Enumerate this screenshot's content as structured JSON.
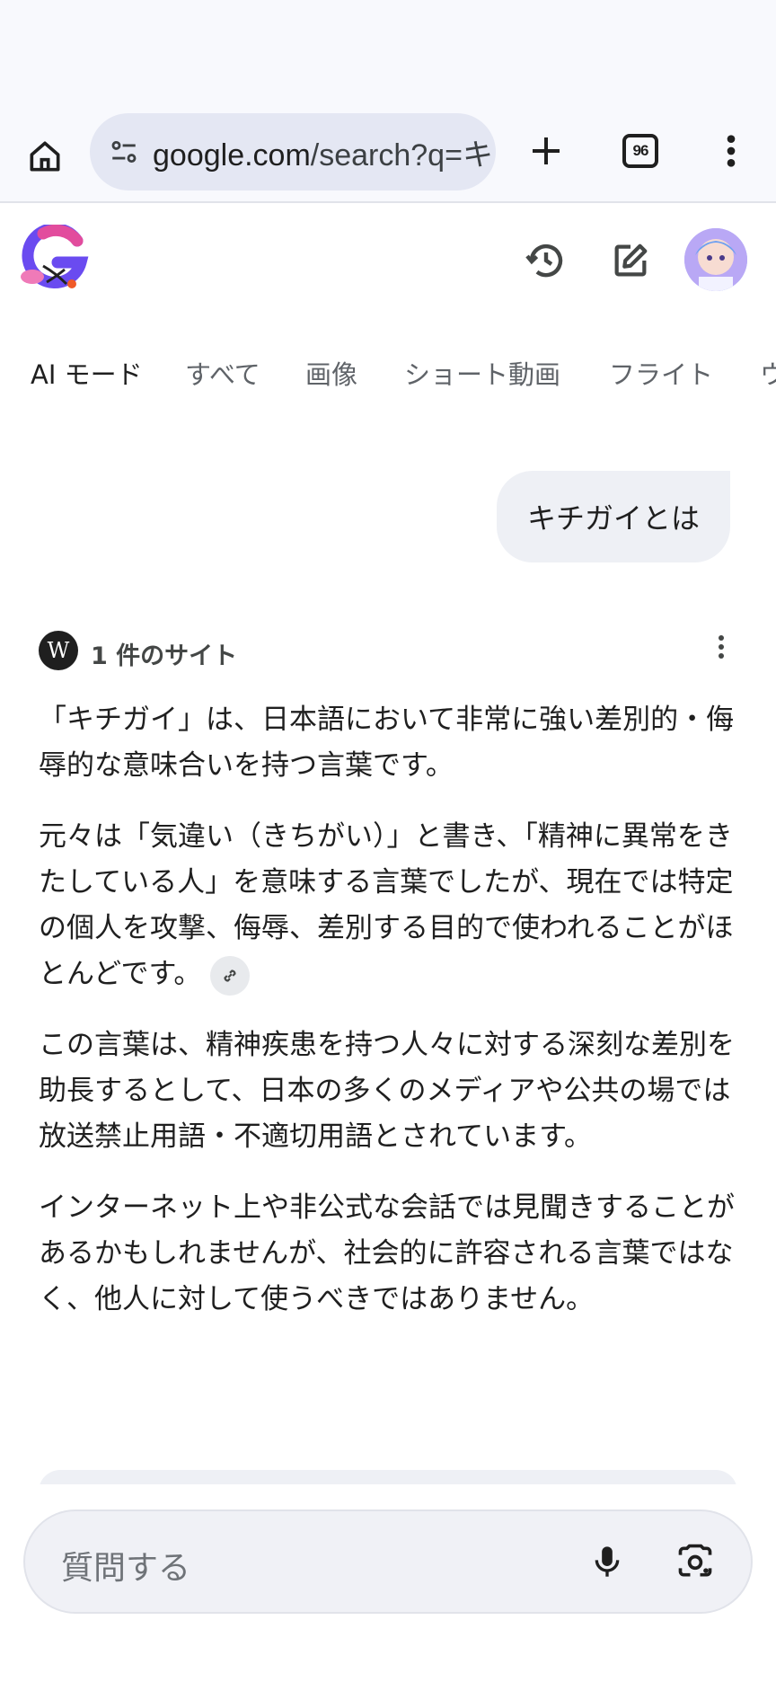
{
  "browser": {
    "url_host": "google.com",
    "url_path": "/search?q=キ",
    "tab_count": "96"
  },
  "filters": [
    "AI モード",
    "すべて",
    "画像",
    "ショート動画",
    "フライト",
    "ウ"
  ],
  "query": "キチガイとは",
  "sources": {
    "label": "1 件のサイト"
  },
  "answer": {
    "paragraphs": [
      "「キチガイ」は、日本語において非常に強い差別的・侮辱的な意味合いを持つ言葉です。",
      "元々は「気違い（きちがい）」と書き、「精神に異常をきたしている人」を意味する言葉でしたが、現在では特定の個人を攻撃、侮辱、差別する目的で使われることがほとんどです。",
      "この言葉は、精神疾患を持つ人々に対する深刻な差別を助長するとして、日本の多くのメディアや公共の場では放送禁止用語・不適切用語とされています。",
      "インターネット上や非公式な会話では見聞きすることがあるかもしれませんが、社会的に許容される言葉ではなく、他人に対して使うべきではありません。"
    ]
  },
  "input": {
    "placeholder": "質問する"
  },
  "icons": {
    "home": "home-icon",
    "site_info": "tune-icon",
    "new_tab": "plus-icon",
    "menu": "more-vert-icon",
    "history": "history-icon",
    "edit": "edit-icon",
    "mic": "mic-icon",
    "lens": "lens-icon",
    "link": "link-icon"
  },
  "colors": {
    "accent_text": "#1f1f1f",
    "muted_text": "#5f6368",
    "pill_bg": "#e4e7f3",
    "bubble_bg": "#eef0f5"
  }
}
